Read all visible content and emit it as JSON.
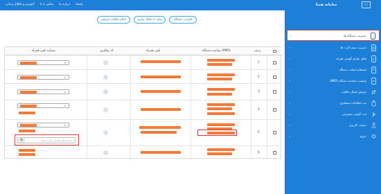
{
  "topbar": {
    "title": "سامانه همتا",
    "window_icon": "maximize-icon",
    "nav": [
      "آموزش و اطلاع رسانی",
      "تماس با ما",
      "درباره ما",
      "راهنما"
    ]
  },
  "sidebar": {
    "items": [
      {
        "label": "مدیریت دستگاه ها",
        "icon": "mobile-icon",
        "active": true
      },
      {
        "label": "مدیریت سیم کارت ها",
        "icon": "sim-card-icon",
        "active": false
      },
      {
        "label": "فعال سازی گوشی همراه",
        "icon": "phone-activate-icon",
        "active": false
      },
      {
        "label": "استعلام اصالت دستگاه",
        "icon": "device-check-icon",
        "active": false
      },
      {
        "label": "وضعیت شناسه دستگاه (IMEI)",
        "icon": "imei-icon",
        "active": false
      },
      {
        "label": "سوابق انتقال مالکیت",
        "icon": "transfer-history-icon",
        "active": false
      },
      {
        "label": "ثبت اطلاعات مسافری",
        "icon": "passenger-icon",
        "active": false
      },
      {
        "label": "ثبت گوشی تعمیراتی",
        "icon": "repair-icon",
        "active": false
      },
      {
        "label": "حساب کاربری",
        "icon": "user-icon",
        "active": false
      },
      {
        "label": "خروج",
        "icon": "logout-icon",
        "active": false
      }
    ]
  },
  "actions": {
    "transfer": "اعلام مالکیت فروش",
    "code": "تولید کد فعال سازی",
    "add": "افزودن دستگاه"
  },
  "table": {
    "headers": {
      "row": "ردیف",
      "imei": "شناسه دستگاه (IMEI)",
      "phone": "تلفن همراه",
      "tracking": "کد رهگیری",
      "number": "شماره تلفن همراه"
    },
    "rows": [
      {
        "num": "1"
      },
      {
        "num": "2"
      },
      {
        "num": "3"
      },
      {
        "num": "4"
      },
      {
        "num": "5"
      },
      {
        "num": "6"
      }
    ],
    "input_placeholder": "شماره تلفن همراه را وارد نمایید"
  },
  "colors": {
    "primary": "#1e7fd8",
    "redaction": "#f47a3a",
    "highlight": "#d93a3a"
  }
}
